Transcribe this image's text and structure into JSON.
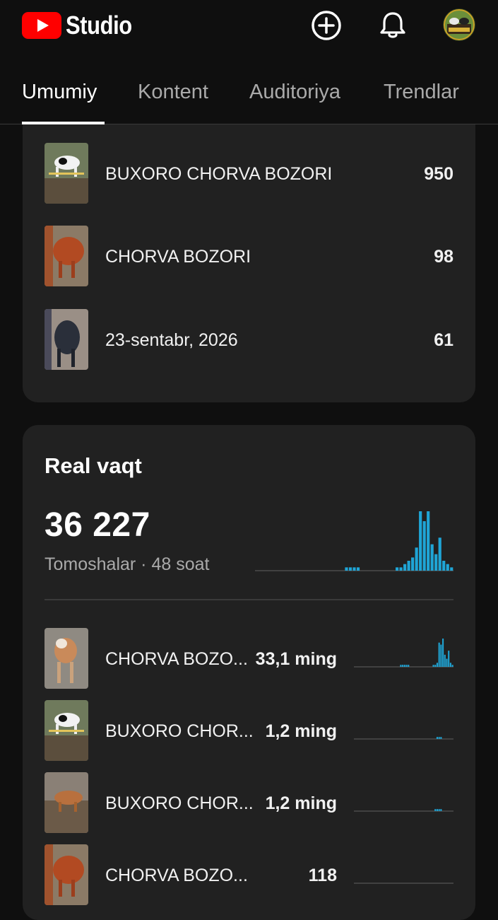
{
  "app": {
    "title": "Studio"
  },
  "icons": {
    "create": "add-circle-icon",
    "notifications": "bell-icon",
    "channel": "avatar"
  },
  "colors": {
    "brand_red": "#ff0000",
    "chart_blue": "#1fa5d6",
    "card_bg": "#212121",
    "page_bg": "#0f0f0f"
  },
  "tabs": [
    {
      "label": "Umumiy",
      "active": true
    },
    {
      "label": "Kontent",
      "active": false
    },
    {
      "label": "Auditoriya",
      "active": false
    },
    {
      "label": "Trendlar",
      "active": false
    }
  ],
  "top_content": {
    "rows": [
      {
        "title": "BUXORO CHORVA BOZORI",
        "value": "950"
      },
      {
        "title": "CHORVA BOZORI",
        "value": "98"
      },
      {
        "title": "23-sentabr, 2026",
        "value": "61"
      }
    ]
  },
  "realtime": {
    "title": "Real vaqt",
    "total": "36 227",
    "subtitle": "Tomoshalar · 48 soat",
    "videos": [
      {
        "title": "CHORVA BOZO...",
        "views": "33,1 ming"
      },
      {
        "title": "BUXORO CHOR...",
        "views": "1,2 ming"
      },
      {
        "title": "BUXORO CHOR...",
        "views": "1,2 ming"
      },
      {
        "title": "CHORVA BOZO...",
        "views": "118"
      }
    ]
  },
  "chart_data": [
    {
      "type": "bar",
      "series": [
        {
          "values": [
            0,
            0,
            0,
            0,
            0,
            0,
            0,
            0,
            0,
            0,
            0,
            0,
            0,
            0,
            0,
            0,
            0,
            0,
            0,
            0,
            0,
            0,
            0,
            1,
            1,
            1,
            1,
            0,
            0,
            0,
            0,
            0,
            0,
            0,
            0,
            0,
            1,
            1,
            2,
            3,
            4,
            7,
            18,
            15,
            18,
            8,
            5,
            10,
            3,
            2,
            1
          ]
        }
      ]
    },
    {
      "type": "bar",
      "series": [
        {
          "values": [
            0,
            0,
            0,
            0,
            0,
            0,
            0,
            0,
            0,
            0,
            0,
            0,
            0,
            0,
            0,
            0,
            0,
            0,
            0,
            0,
            0,
            0,
            0,
            0,
            1,
            1,
            1,
            1,
            1,
            0,
            0,
            0,
            0,
            0,
            0,
            0,
            0,
            0,
            0,
            0,
            0,
            1,
            1,
            2,
            12,
            11,
            14,
            6,
            4,
            8,
            2,
            1
          ]
        }
      ]
    },
    {
      "type": "bar",
      "series": [
        {
          "values": [
            0,
            0,
            0,
            0,
            0,
            0,
            0,
            0,
            0,
            0,
            0,
            0,
            0,
            0,
            0,
            0,
            0,
            0,
            0,
            0,
            0,
            0,
            0,
            0,
            0,
            0,
            0,
            0,
            0,
            0,
            0,
            0,
            0,
            0,
            0,
            0,
            0,
            0,
            0,
            0,
            0,
            0,
            0,
            1,
            1,
            1,
            0,
            0,
            0,
            0,
            0,
            0
          ]
        }
      ]
    },
    {
      "type": "bar",
      "series": [
        {
          "values": [
            0,
            0,
            0,
            0,
            0,
            0,
            0,
            0,
            0,
            0,
            0,
            0,
            0,
            0,
            0,
            0,
            0,
            0,
            0,
            0,
            0,
            0,
            0,
            0,
            0,
            0,
            0,
            0,
            0,
            0,
            0,
            0,
            0,
            0,
            0,
            0,
            0,
            0,
            0,
            0,
            0,
            0,
            1,
            1,
            1,
            1,
            0,
            0,
            0,
            0,
            0,
            0
          ]
        }
      ]
    },
    {
      "type": "bar",
      "series": [
        {
          "values": [
            0,
            0,
            0,
            0,
            0,
            0,
            0,
            0,
            0,
            0,
            0,
            0,
            0,
            0,
            0,
            0,
            0,
            0,
            0,
            0,
            0,
            0,
            0,
            0,
            0,
            0,
            0,
            0,
            0,
            0,
            0,
            0,
            0,
            0,
            0,
            0,
            0,
            0,
            0,
            0,
            0,
            0,
            0,
            0,
            0,
            0,
            0,
            0,
            0,
            0,
            0,
            0
          ]
        }
      ]
    }
  ]
}
